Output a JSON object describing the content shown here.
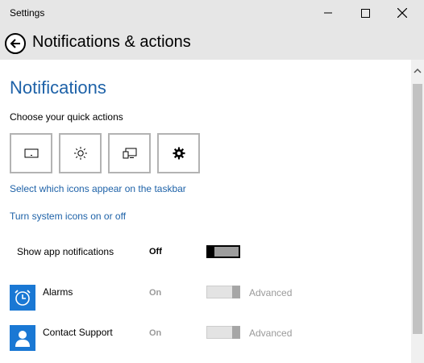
{
  "window": {
    "title": "Settings"
  },
  "header": {
    "title": "Notifications & actions"
  },
  "section": {
    "heading": "Notifications",
    "quick_actions_label": "Choose your quick actions",
    "quick_action_icons": [
      "tablet-mode-icon",
      "brightness-icon",
      "connect-display-icon",
      "settings-gear-icon"
    ],
    "link_taskbar": "Select which icons appear on the taskbar",
    "link_system_icons": "Turn system icons on or off"
  },
  "show_app_notifications": {
    "label": "Show app notifications",
    "state": "Off",
    "toggle_on": false
  },
  "apps": [
    {
      "name": "Alarms",
      "state": "On",
      "toggle_on": true,
      "advanced": "Advanced",
      "icon": "alarm-clock-icon"
    },
    {
      "name": "Contact Support",
      "state": "On",
      "toggle_on": true,
      "advanced": "Advanced",
      "icon": "person-icon"
    }
  ],
  "colors": {
    "accent": "#1e62a8",
    "chrome": "#e6e6e6",
    "app_icon_bg": "#1a78d4"
  }
}
